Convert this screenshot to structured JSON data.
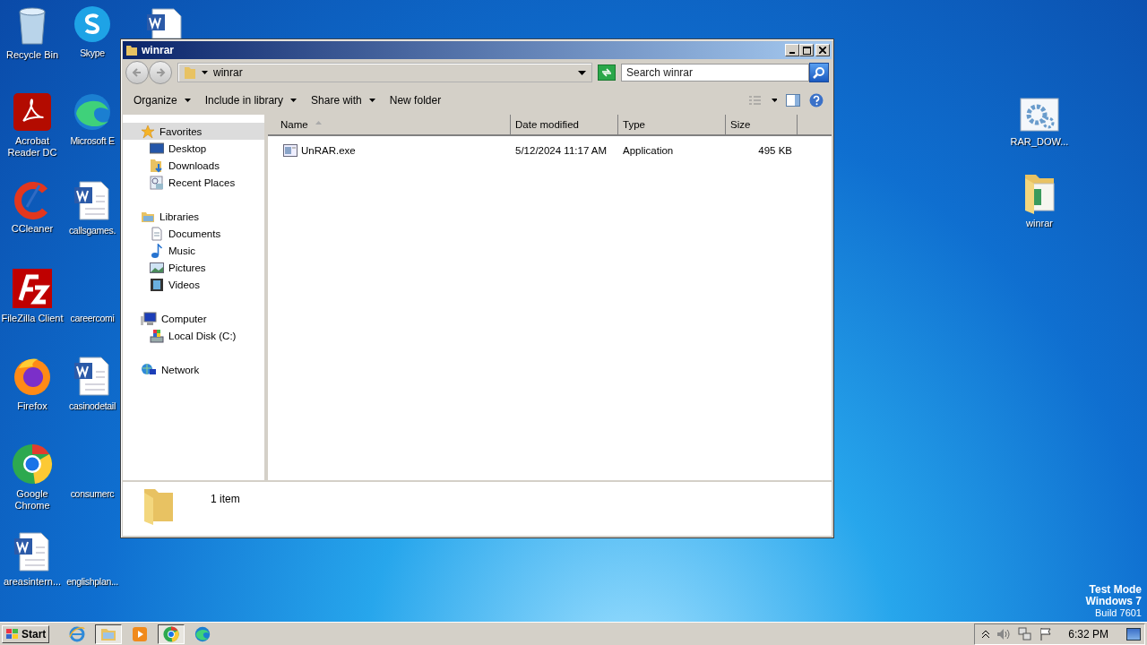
{
  "desktop": {
    "left_icons": [
      {
        "kind": "recycle",
        "label": "Recycle Bin"
      },
      {
        "kind": "skype",
        "label": "Skype"
      },
      {
        "kind": "acrobat",
        "label": "Acrobat Reader DC"
      },
      {
        "kind": "edge",
        "label": "Microsoft E"
      },
      {
        "kind": "ccleaner",
        "label": "CCleaner"
      },
      {
        "kind": "word",
        "label": "callsgames."
      },
      {
        "kind": "filezilla",
        "label": "FileZilla Client"
      },
      {
        "kind": "blank",
        "label": "careercomi"
      },
      {
        "kind": "firefox",
        "label": "Firefox"
      },
      {
        "kind": "word",
        "label": "casinodetail"
      },
      {
        "kind": "chrome",
        "label": "Google Chrome"
      },
      {
        "kind": "blank",
        "label": "consumerc"
      },
      {
        "kind": "word",
        "label": "areasintern..."
      },
      {
        "kind": "blank",
        "label": "englishplan..."
      }
    ],
    "right_icons": [
      {
        "kind": "setup",
        "label": "RAR_DOW..."
      },
      {
        "kind": "folder",
        "label": "winrar"
      }
    ]
  },
  "window": {
    "title": "winrar",
    "address": "winrar",
    "search": {
      "placeholder": "Search winrar"
    },
    "toolbar": [
      {
        "label": "Organize",
        "dropdown": true
      },
      {
        "label": "Include in library",
        "dropdown": true
      },
      {
        "label": "Share with",
        "dropdown": true
      },
      {
        "label": "New folder",
        "dropdown": false
      }
    ],
    "nav": [
      {
        "kind": "favorites",
        "label": "Favorites",
        "selected": true,
        "children": [
          {
            "kind": "desktop",
            "label": "Desktop",
            "selected": false
          },
          {
            "kind": "downloads",
            "label": "Downloads",
            "selected": false
          },
          {
            "kind": "recent",
            "label": "Recent Places",
            "selected": false
          }
        ]
      },
      {
        "kind": "libraries",
        "label": "Libraries",
        "selected": false,
        "children": [
          {
            "kind": "documents",
            "label": "Documents",
            "selected": false
          },
          {
            "kind": "music",
            "label": "Music",
            "selected": false
          },
          {
            "kind": "pictures",
            "label": "Pictures",
            "selected": false
          },
          {
            "kind": "videos",
            "label": "Videos",
            "selected": false
          }
        ]
      },
      {
        "kind": "computer",
        "label": "Computer",
        "selected": false,
        "children": [
          {
            "kind": "disk",
            "label": "Local Disk (C:)",
            "selected": false
          }
        ]
      },
      {
        "kind": "network",
        "label": "Network",
        "selected": false
      }
    ],
    "columns": [
      {
        "label": "Name",
        "sorted": true
      },
      {
        "label": "Date modified",
        "sorted": false
      },
      {
        "label": "Type",
        "sorted": false
      },
      {
        "label": "Size",
        "sorted": false
      }
    ],
    "rows": [
      {
        "name": "UnRAR.exe",
        "date_modified": "5/12/2024 11:17 AM",
        "type": "Application",
        "size": "495 KB",
        "selected": false
      }
    ],
    "status": "1 item"
  },
  "system_notice": [
    "Test Mode",
    "Windows 7",
    "Build 7601"
  ],
  "taskbar": {
    "start": "Start",
    "apps": [
      {
        "kind": "ie",
        "active": false
      },
      {
        "kind": "explorer",
        "active": true
      },
      {
        "kind": "media",
        "active": false
      },
      {
        "kind": "chrome",
        "active": true
      },
      {
        "kind": "edge",
        "active": false
      }
    ],
    "clock": "6:32 PM"
  }
}
